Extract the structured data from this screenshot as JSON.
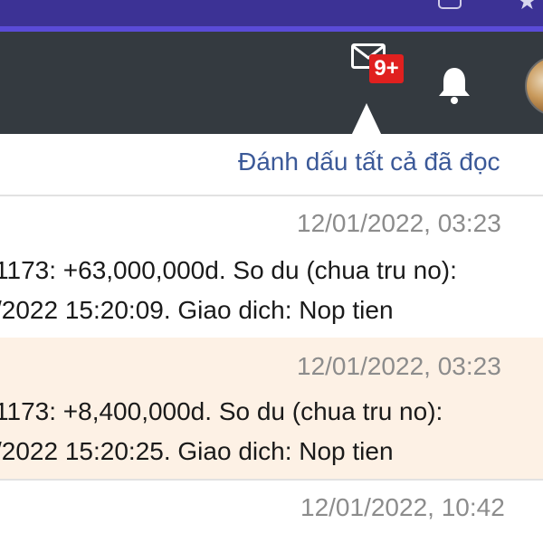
{
  "header": {
    "mail_badge": "9+"
  },
  "dropdown": {
    "mark_all_label": "Đánh dấu tất cả đã đọc",
    "notifications": [
      {
        "time": "12/01/2022, 03:23",
        "line1": "1173: +63,000,000d. So du (chua tru no):",
        "line2": "/2022 15:20:09. Giao dich: Nop tien",
        "unread": false
      },
      {
        "time": "12/01/2022, 03:23",
        "line1": "1173: +8,400,000d. So du (chua tru no):",
        "line2": "/2022 15:20:25. Giao dich: Nop tien",
        "unread": true
      },
      {
        "time": "12/01/2022, 10:42",
        "line1": "",
        "line2": "",
        "unread": false
      }
    ]
  },
  "colors": {
    "browser_bar": "#3c3295",
    "header_bg": "#343a40",
    "badge_bg": "#e0201f",
    "link": "#3b5998",
    "unread_bg": "#fdf1e5"
  }
}
